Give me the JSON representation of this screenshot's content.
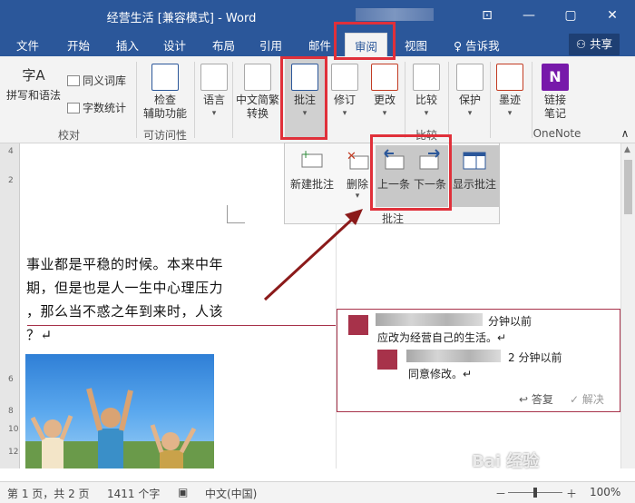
{
  "window": {
    "title": "经营生活 [兼容模式]  -  Word",
    "min_glyph": "—",
    "restore_glyph": "▢",
    "close_glyph": "✕",
    "ribbon_options_glyph": "⊡"
  },
  "tabs": [
    {
      "label": "文件"
    },
    {
      "label": "开始"
    },
    {
      "label": "插入"
    },
    {
      "label": "设计"
    },
    {
      "label": "布局"
    },
    {
      "label": "引用"
    },
    {
      "label": "邮件"
    },
    {
      "label": "审阅"
    },
    {
      "label": "视图"
    }
  ],
  "tellme": "告诉我",
  "share": "共享",
  "ribbon": {
    "spelling": "拼写和语法",
    "thesaurus": "同义词库",
    "wordcount": "字数统计",
    "group_proofing": "校对",
    "check_access_1": "检查",
    "check_access_2": "辅助功能",
    "group_access": "可访问性",
    "language": "语言",
    "chinese_1": "中文简繁",
    "chinese_2": "转换",
    "comment": "批注",
    "revise": "修订",
    "changes": "更改",
    "compare": "比较",
    "group_compare": "比较",
    "protect": "保护",
    "ink": "墨迹",
    "link_1": "链接",
    "link_2": "笔记",
    "group_onenote": "OneNote"
  },
  "comment_panel": {
    "new_comment": "新建批注",
    "delete": "删除",
    "previous": "上一条",
    "next": "下一条",
    "show_comments": "显示批注",
    "group_label": "批注"
  },
  "document": {
    "lines": [
      "事业都是平稳的时候。本来中年",
      "期，但是也是人一生中心理压力",
      "，那么当不惑之年到来时，人该",
      "？↵"
    ]
  },
  "comments": [
    {
      "time": "分钟以前",
      "text": "应改为经营自己的生活。↵"
    },
    {
      "time": "2 分钟以前",
      "text": "同意修改。↵"
    }
  ],
  "comment_actions": {
    "reply": "答复",
    "resolve": "解决"
  },
  "status": {
    "page": "第 1 页，共 2 页",
    "words": "1411 个字",
    "lang": "中文(中国)",
    "zoom": "100%",
    "zoom_minus": "－",
    "zoom_plus": "＋"
  },
  "watermark": "Bai 经验",
  "colors": {
    "word_blue": "#2b579a",
    "comment_accent": "#a7324a",
    "highlight": "#e0303a"
  }
}
